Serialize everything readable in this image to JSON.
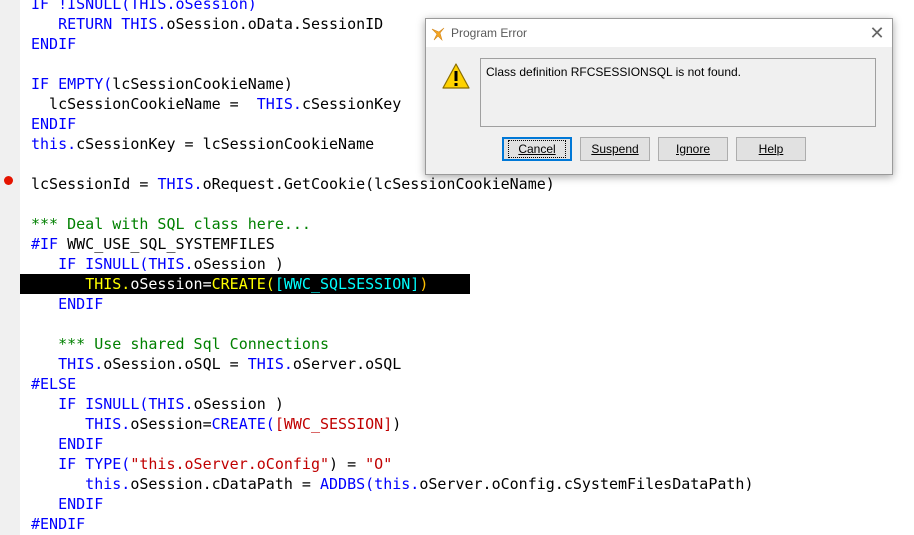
{
  "editor": {
    "lines": [
      [
        {
          "t": "IF !ISNULL(THIS.oSession)",
          "c": "kw"
        }
      ],
      [
        {
          "t": "   RETURN THIS.",
          "c": "kw"
        },
        {
          "t": "oSession.oData.SessionID",
          "c": ""
        }
      ],
      [
        {
          "t": "ENDIF",
          "c": "kw"
        }
      ],
      [
        {
          "t": "",
          "c": ""
        }
      ],
      [
        {
          "t": "IF EMPTY(",
          "c": "kw"
        },
        {
          "t": "lcSessionCookieName)",
          "c": ""
        }
      ],
      [
        {
          "t": "  lcSessionCookieName =  ",
          "c": ""
        },
        {
          "t": "THIS.",
          "c": "kw"
        },
        {
          "t": "cSessionKey",
          "c": ""
        }
      ],
      [
        {
          "t": "ENDIF",
          "c": "kw"
        }
      ],
      [
        {
          "t": "this.",
          "c": "kw"
        },
        {
          "t": "cSessionKey = lcSessionCookieName",
          "c": ""
        }
      ],
      [
        {
          "t": "",
          "c": ""
        }
      ],
      [
        {
          "t": "lcSessionId = ",
          "c": ""
        },
        {
          "t": "THIS.",
          "c": "kw"
        },
        {
          "t": "oRequest.GetCookie(lcSessionCookieName)",
          "c": ""
        }
      ],
      [
        {
          "t": "",
          "c": ""
        }
      ],
      [
        {
          "t": "*** Deal with SQL class here...",
          "c": "cmt"
        }
      ],
      [
        {
          "t": "#IF ",
          "c": "kw"
        },
        {
          "t": "WWC_USE_SQL_SYSTEMFILES",
          "c": ""
        }
      ],
      [
        {
          "t": "   IF ISNULL(THIS.",
          "c": "kw"
        },
        {
          "t": "oSession )",
          "c": ""
        }
      ],
      [
        {
          "t": "      ",
          "c": ""
        },
        {
          "t": "THIS.",
          "c": "kw2"
        },
        {
          "t": "oSession=",
          "c": ""
        },
        {
          "t": "CREATE(",
          "c": "kw2"
        },
        {
          "t": "[WWC_SQLSESSION]",
          "c": "const"
        },
        {
          "t": ")",
          "c": "paren"
        }
      ],
      [
        {
          "t": "   ENDIF",
          "c": "kw"
        }
      ],
      [
        {
          "t": "",
          "c": ""
        }
      ],
      [
        {
          "t": "   *** Use shared Sql Connections",
          "c": "cmt"
        }
      ],
      [
        {
          "t": "   THIS.",
          "c": "kw"
        },
        {
          "t": "oSession.oSQL = ",
          "c": ""
        },
        {
          "t": "THIS.",
          "c": "kw"
        },
        {
          "t": "oServer.oSQL",
          "c": ""
        }
      ],
      [
        {
          "t": "#ELSE",
          "c": "kw"
        }
      ],
      [
        {
          "t": "   IF ISNULL(THIS.",
          "c": "kw"
        },
        {
          "t": "oSession )",
          "c": ""
        }
      ],
      [
        {
          "t": "      THIS.",
          "c": "kw"
        },
        {
          "t": "oSession=",
          "c": ""
        },
        {
          "t": "CREATE(",
          "c": "kw"
        },
        {
          "t": "[WWC_SESSION]",
          "c": "str"
        },
        {
          "t": ")",
          "c": ""
        }
      ],
      [
        {
          "t": "   ENDIF",
          "c": "kw"
        }
      ],
      [
        {
          "t": "   IF TYPE(",
          "c": "kw"
        },
        {
          "t": "\"this.oServer.oConfig\"",
          "c": "str"
        },
        {
          "t": ") = ",
          "c": ""
        },
        {
          "t": "\"O\"",
          "c": "str"
        }
      ],
      [
        {
          "t": "      this.",
          "c": "kw"
        },
        {
          "t": "oSession.cDataPath = ",
          "c": ""
        },
        {
          "t": "ADDBS(this.",
          "c": "kw"
        },
        {
          "t": "oServer.oConfig.cSystemFilesDataPath)",
          "c": ""
        }
      ],
      [
        {
          "t": "   ENDIF",
          "c": "kw"
        }
      ],
      [
        {
          "t": "#ENDIF",
          "c": "kw"
        }
      ]
    ],
    "highlighted_line": 14,
    "breakpoint_line": 9
  },
  "dialog": {
    "title": "Program Error",
    "message": "Class definition RFCSESSIONSQL is not found.",
    "buttons": {
      "cancel": "Cancel",
      "suspend": "Suspend",
      "ignore": "Ignore",
      "help": "Help"
    },
    "close_glyph": "✕",
    "icon": "warning-icon"
  },
  "colors": {
    "keyword": "#0000ff",
    "string": "#c00000",
    "comment": "#008000",
    "highlight_bg": "#000000",
    "breakpoint": "#e51400",
    "default_button_border": "#0078d7"
  }
}
